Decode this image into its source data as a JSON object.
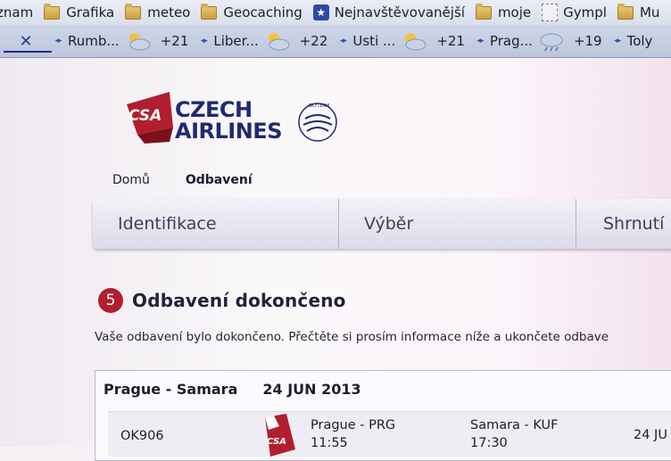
{
  "bookmarks": [
    {
      "label": "znam",
      "icon": "none"
    },
    {
      "label": "Grafika",
      "icon": "folder-icon"
    },
    {
      "label": "meteo",
      "icon": "folder-icon"
    },
    {
      "label": "Geocaching",
      "icon": "folder-icon"
    },
    {
      "label": "Nejnavštěvovanější",
      "icon": "bookmark-star-icon"
    },
    {
      "label": "moje",
      "icon": "folder-icon"
    },
    {
      "label": "Gympl",
      "icon": "page-icon"
    },
    {
      "label": "Mu",
      "icon": "folder-icon"
    }
  ],
  "tabs": [
    {
      "label": "Rumb...",
      "temp": "+21"
    },
    {
      "label": "Liber...",
      "temp": "+22"
    },
    {
      "label": "Usti ...",
      "temp": "+21"
    },
    {
      "label": "Prag...",
      "temp": "+19"
    },
    {
      "label": "Toly",
      "temp": ""
    }
  ],
  "tab_close": "✕",
  "logo": {
    "badge": "CSA",
    "line1": "CZECH",
    "line2": "AIRLINES",
    "alliance": "SKYTEAM"
  },
  "nav": {
    "home": "Domů",
    "checkin": "Odbavení"
  },
  "steps": [
    "Identifikace",
    "Výběr",
    "Shrnutí"
  ],
  "heading": {
    "step_number": "5",
    "title": "Odbavení dokončeno"
  },
  "info_text": "Vaše odbavení bylo dokončeno. Přečtěte si prosím informace níže a ukončete odbave",
  "route": {
    "from_to": "Prague - Samara",
    "date": "24 JUN 2013"
  },
  "flight": {
    "number": "OK906",
    "badge": "CSA",
    "departure": {
      "place": "Prague - PRG",
      "time": "11:55"
    },
    "arrival": {
      "place": "Samara - KUF",
      "time": "17:30"
    },
    "date": "24 JU"
  },
  "colors": {
    "brand_red": "#b11e2e",
    "brand_blue": "#1f2a72"
  }
}
